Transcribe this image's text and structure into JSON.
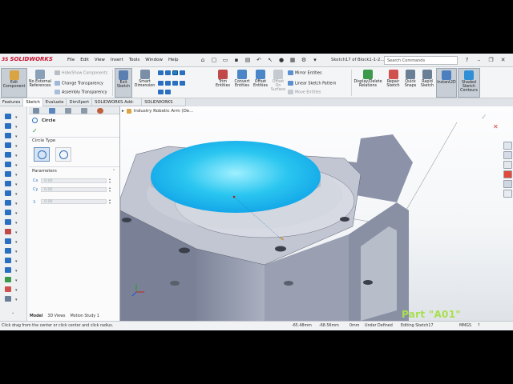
{
  "app": {
    "brand": "SOLIDWORKS",
    "brand_prefix": "3S"
  },
  "menu": [
    "File",
    "Edit",
    "View",
    "Insert",
    "Tools",
    "Window",
    "Help"
  ],
  "window_title": "Sketch17 of Block1-1-2...",
  "search": {
    "placeholder": "Search Commands"
  },
  "commands": {
    "edit_component": "Edit Component",
    "no_external_refs": "No External References",
    "hide_show": "Hide/Show Components",
    "change_transparency": "Change Transparency",
    "assembly_transparency": "Assembly Transparency",
    "exit_sketch": "Exit Sketch",
    "smart_dimension": "Smart Dimension",
    "trim_entities": "Trim Entities",
    "convert_entities": "Convert Entities",
    "offset_entities": "Offset Entities",
    "offset_on_surface": "Offset On Surface",
    "mirror_entities": "Mirror Entities",
    "linear_sketch_pattern": "Linear Sketch Pattern",
    "move_entities": "Move Entities",
    "display_delete_relations": "Display/Delete Relations",
    "repair_sketch": "Repair Sketch",
    "quick_snaps": "Quick Snaps",
    "rapid_sketch": "Rapid Sketch",
    "instant2d": "Instant2D",
    "shaded_sketch_contours": "Shaded Sketch Contours"
  },
  "tabs": [
    "Features",
    "Sketch",
    "Evaluate",
    "DimXpert",
    "SOLIDWORKS Add-Ins",
    "SOLIDWORKS MBD"
  ],
  "active_tab": "Sketch",
  "property_manager": {
    "title": "Circle",
    "circle_type_label": "Circle Type",
    "parameters_label": "Parameters",
    "param_values": [
      "0.00",
      "0.00",
      "0.00"
    ]
  },
  "tree": {
    "root": "Industry Robotic Arm (De..."
  },
  "bottom_tabs": [
    "Model",
    "3D Views",
    "Motion Study 1"
  ],
  "status": {
    "hint": "Click drag from the center or click center and click radius.",
    "x": "-65.48mm",
    "y": "-68.56mm",
    "z": "0mm",
    "state": "Under Defined",
    "editing": "Editing Sketch17",
    "units": "MMGS"
  },
  "overlay_label": "Part \"A01\"",
  "colors": {
    "accent_blue": "#1a7fd0",
    "highlight_circle": "#2bc6f0",
    "brand_red": "#c8102e",
    "label_green": "#a8e04d"
  }
}
